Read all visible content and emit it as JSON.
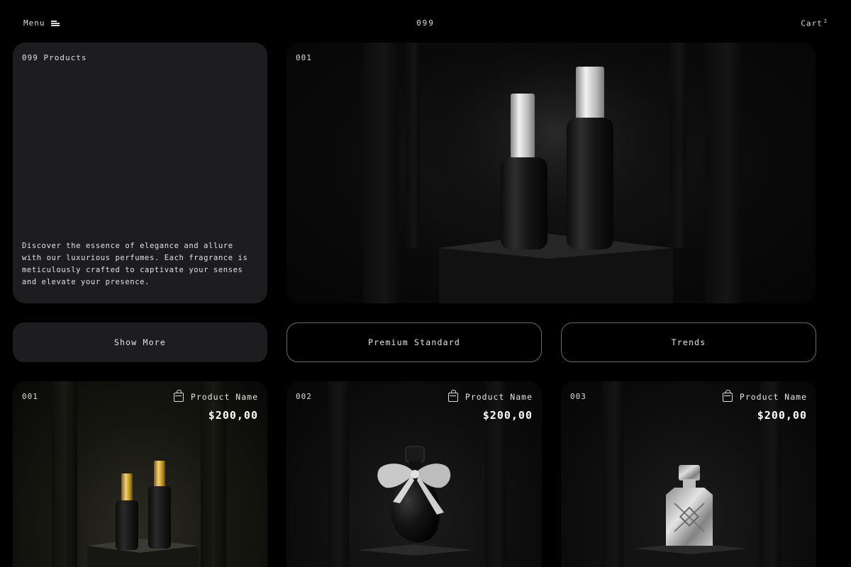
{
  "header": {
    "menu_label": "Menu",
    "brand": "099",
    "cart_label": "Cart",
    "cart_count": "2"
  },
  "intro": {
    "tag": "099 Products",
    "description": "Discover the essence of elegance and allure with our luxurious perfumes. Each fragrance is meticulously crafted to captivate your senses and elevate your presence."
  },
  "hero": {
    "number": "001"
  },
  "buttons": {
    "show_more": "Show More",
    "premium": "Premium Standard",
    "trends": "Trends"
  },
  "products": [
    {
      "number": "001",
      "name": "Product Name",
      "price": "$200,00"
    },
    {
      "number": "002",
      "name": "Product Name",
      "price": "$200,00"
    },
    {
      "number": "003",
      "name": "Product Name",
      "price": "$200,00"
    }
  ],
  "icons": {
    "menu": "menu-icon",
    "bag": "shopping-bag-icon"
  },
  "colors": {
    "background": "#000000",
    "card": "#1d1d1f",
    "outline": "#6a6a6a",
    "text": "#e6e6e6"
  }
}
